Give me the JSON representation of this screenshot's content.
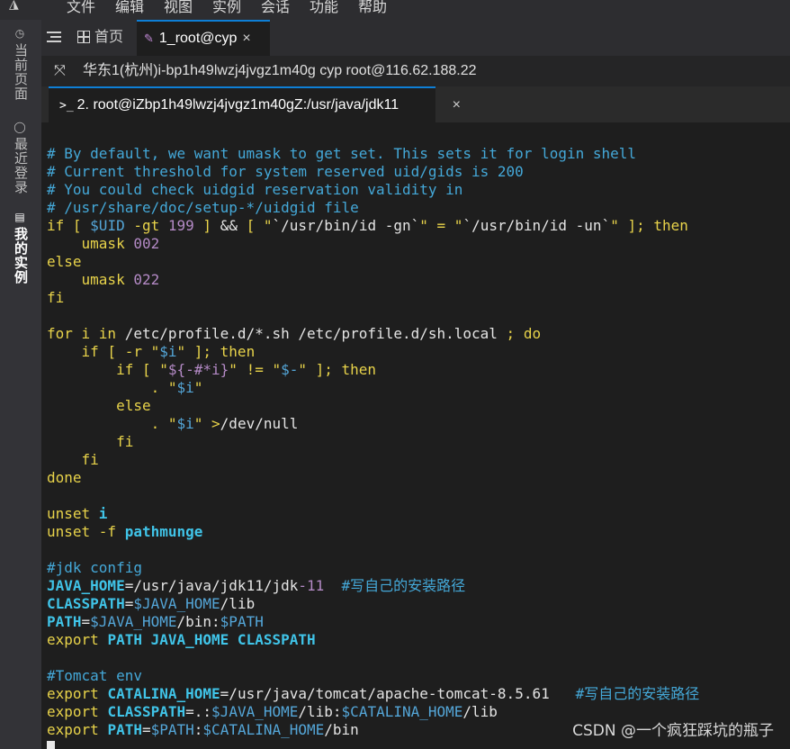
{
  "menu": {
    "items": [
      "文件",
      "编辑",
      "视图",
      "实例",
      "会话",
      "功能",
      "帮助"
    ]
  },
  "sidebar": {
    "items": [
      {
        "label": "当前页面"
      },
      {
        "label": "最近登录"
      },
      {
        "label": "我的实例"
      }
    ]
  },
  "tabs": {
    "home_label": "首页",
    "active_label": "1_root@cyp"
  },
  "connection": {
    "text": "华东1(杭州)i-bp1h49lwzj4jvgz1m40g   cyp   root@116.62.188.22"
  },
  "session": {
    "label": "2. root@iZbp1h49lwzj4jvgz1m40gZ:/usr/java/jdk11"
  },
  "terminal": {
    "lines": [
      [
        {
          "t": "# By default, we want umask to get set. This sets it for login shell",
          "c": "c"
        }
      ],
      [
        {
          "t": "# Current threshold for system reserved uid/gids is 200",
          "c": "c"
        }
      ],
      [
        {
          "t": "# You could check uidgid reservation validity in",
          "c": "c"
        }
      ],
      [
        {
          "t": "# /usr/share/doc/setup-*/uidgid file",
          "c": "c"
        }
      ],
      [
        {
          "t": "if [ ",
          "c": "y"
        },
        {
          "t": "$UID",
          "c": "b"
        },
        {
          "t": " -gt ",
          "c": "y"
        },
        {
          "t": "199",
          "c": "p"
        },
        {
          "t": " ] ",
          "c": "y"
        },
        {
          "t": "&& ",
          "c": "w"
        },
        {
          "t": "[ \"",
          "c": "y"
        },
        {
          "t": "`/usr/bin/id -gn`",
          "c": "w"
        },
        {
          "t": "\" = \"",
          "c": "y"
        },
        {
          "t": "`/usr/bin/id -un`",
          "c": "w"
        },
        {
          "t": "\" ]; then",
          "c": "y"
        }
      ],
      [
        {
          "t": "    umask ",
          "c": "y"
        },
        {
          "t": "002",
          "c": "p"
        }
      ],
      [
        {
          "t": "else",
          "c": "y"
        }
      ],
      [
        {
          "t": "    umask ",
          "c": "y"
        },
        {
          "t": "022",
          "c": "p"
        }
      ],
      [
        {
          "t": "fi",
          "c": "y"
        }
      ],
      [
        {
          "t": "",
          "c": "w"
        }
      ],
      [
        {
          "t": "for i in ",
          "c": "y"
        },
        {
          "t": "/etc/profile.d/*.sh /etc/profile.d/sh.local ",
          "c": "w"
        },
        {
          "t": "; do",
          "c": "y"
        }
      ],
      [
        {
          "t": "    if [ -r \"",
          "c": "y"
        },
        {
          "t": "$i",
          "c": "b"
        },
        {
          "t": "\" ]; then",
          "c": "y"
        }
      ],
      [
        {
          "t": "        if [ \"",
          "c": "y"
        },
        {
          "t": "${-#*i}",
          "c": "p"
        },
        {
          "t": "\" != \"",
          "c": "y"
        },
        {
          "t": "$-",
          "c": "b"
        },
        {
          "t": "\" ]; then",
          "c": "y"
        }
      ],
      [
        {
          "t": "            . \"",
          "c": "y"
        },
        {
          "t": "$i",
          "c": "b"
        },
        {
          "t": "\"",
          "c": "y"
        }
      ],
      [
        {
          "t": "        else",
          "c": "y"
        }
      ],
      [
        {
          "t": "            . \"",
          "c": "y"
        },
        {
          "t": "$i",
          "c": "b"
        },
        {
          "t": "\" >",
          "c": "y"
        },
        {
          "t": "/dev/null",
          "c": "w"
        }
      ],
      [
        {
          "t": "        fi",
          "c": "y"
        }
      ],
      [
        {
          "t": "    fi",
          "c": "y"
        }
      ],
      [
        {
          "t": "done",
          "c": "y"
        }
      ],
      [
        {
          "t": "",
          "c": "w"
        }
      ],
      [
        {
          "t": "unset ",
          "c": "y"
        },
        {
          "t": "i",
          "c": "cb"
        }
      ],
      [
        {
          "t": "unset -f ",
          "c": "y"
        },
        {
          "t": "pathmunge",
          "c": "cb"
        }
      ],
      [
        {
          "t": "",
          "c": "w"
        }
      ],
      [
        {
          "t": "#jdk config",
          "c": "c"
        }
      ],
      [
        {
          "t": "JAVA_HOME",
          "c": "cb"
        },
        {
          "t": "=/usr/java/jdk11/jdk",
          "c": "w"
        },
        {
          "t": "-11",
          "c": "p"
        },
        {
          "t": "  #写自己的安装路径",
          "c": "c"
        }
      ],
      [
        {
          "t": "CLASSPATH",
          "c": "cb"
        },
        {
          "t": "=",
          "c": "w"
        },
        {
          "t": "$JAVA_HOME",
          "c": "b"
        },
        {
          "t": "/lib",
          "c": "w"
        }
      ],
      [
        {
          "t": "PATH",
          "c": "cb"
        },
        {
          "t": "=",
          "c": "w"
        },
        {
          "t": "$JAVA_HOME",
          "c": "b"
        },
        {
          "t": "/bin:",
          "c": "w"
        },
        {
          "t": "$PATH",
          "c": "b"
        }
      ],
      [
        {
          "t": "export ",
          "c": "y"
        },
        {
          "t": "PATH JAVA_HOME CLASSPATH",
          "c": "cb"
        }
      ],
      [
        {
          "t": "",
          "c": "w"
        }
      ],
      [
        {
          "t": "#Tomcat env",
          "c": "c"
        }
      ],
      [
        {
          "t": "export ",
          "c": "y"
        },
        {
          "t": "CATALINA_HOME",
          "c": "cb"
        },
        {
          "t": "=/usr/java/tomcat/apache-tomcat-8.5.61   ",
          "c": "w"
        },
        {
          "t": "#写自己的安装路径",
          "c": "c"
        }
      ],
      [
        {
          "t": "export ",
          "c": "y"
        },
        {
          "t": "CLASSPATH",
          "c": "cb"
        },
        {
          "t": "=.:",
          "c": "w"
        },
        {
          "t": "$JAVA_HOME",
          "c": "b"
        },
        {
          "t": "/lib:",
          "c": "w"
        },
        {
          "t": "$CATALINA_HOME",
          "c": "b"
        },
        {
          "t": "/lib",
          "c": "w"
        }
      ],
      [
        {
          "t": "export ",
          "c": "y"
        },
        {
          "t": "PATH",
          "c": "cb"
        },
        {
          "t": "=",
          "c": "w"
        },
        {
          "t": "$PATH",
          "c": "b"
        },
        {
          "t": ":",
          "c": "w"
        },
        {
          "t": "$CATALINA_HOME",
          "c": "b"
        },
        {
          "t": "/bin",
          "c": "w"
        }
      ]
    ]
  },
  "watermark": "CSDN @一个疯狂踩坑的瓶子",
  "colors": {
    "comment": "#44a8d8",
    "keyword": "#e8d34a",
    "variable": "#54a6d8",
    "number": "#b48ac6",
    "accent": "#0e7fd6"
  },
  "icons": {
    "logo": "app-logo-icon",
    "menu": "hamburger-menu-icon",
    "home": "grid-home-icon",
    "pin": "pin-icon",
    "expand": "expand-icon",
    "prompt": "terminal-prompt-icon"
  }
}
